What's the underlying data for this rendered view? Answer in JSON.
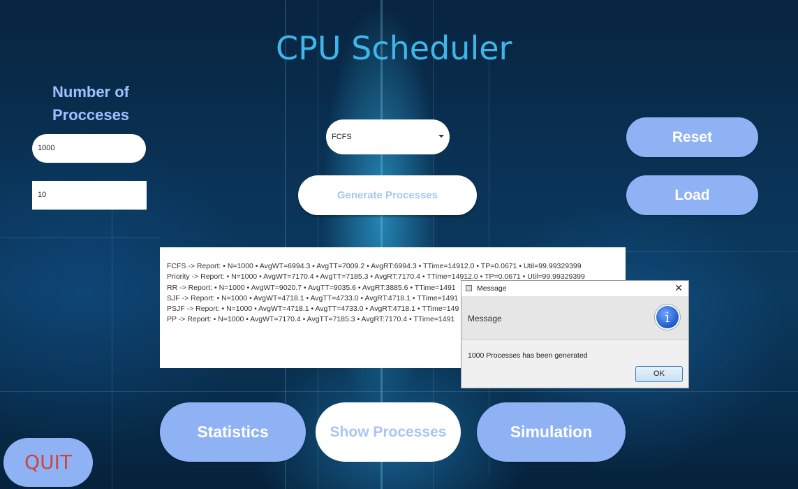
{
  "title": "CPU Scheduler",
  "number_label_line1": "Number of",
  "number_label_line2": "Procceses",
  "inputs": {
    "process_count": "1000",
    "second_value": "10"
  },
  "algorithm_select": {
    "selected": "FCFS"
  },
  "buttons": {
    "generate": "Generate Processes",
    "reset": "Reset",
    "load": "Load",
    "statistics": "Statistics",
    "show_processes": "Show Processes",
    "simulation": "Simulation",
    "quit": "QUIT"
  },
  "report_lines": [
    " FCFS -> Report: • N=1000 • AvgWT=6994.3 • AvgTT=7009.2 • AvgRT:6994.3 • TTime=14912.0 • TP=0.0671 • Util=99.99329399",
    "Priority -> Report: • N=1000 • AvgWT=7170.4 • AvgTT=7185.3 • AvgRT:7170.4 • TTime=14912.0 • TP=0.0671 • Util=99.99329399",
    "RR -> Report: • N=1000 • AvgWT=9020.7 • AvgTT=9035.6 • AvgRT:3885.6 • TTime=1491",
    "SJF -> Report: • N=1000 • AvgWT=4718.1 • AvgTT=4733.0 • AvgRT:4718.1 • TTime=1491",
    "PSJF -> Report: • N=1000 • AvgWT=4718.1 • AvgTT=4733.0 • AvgRT:4718.1 • TTime=149",
    "PP -> Report: • N=1000 • AvgWT=7170.4 • AvgTT=7185.3 • AvgRT:7170.4 • TTime=1491"
  ],
  "dialog": {
    "window_title": "Message",
    "header": "Message",
    "message": "1000 Processes has been generated",
    "ok": "OK",
    "close_glyph": "✕",
    "info_glyph": "i"
  }
}
